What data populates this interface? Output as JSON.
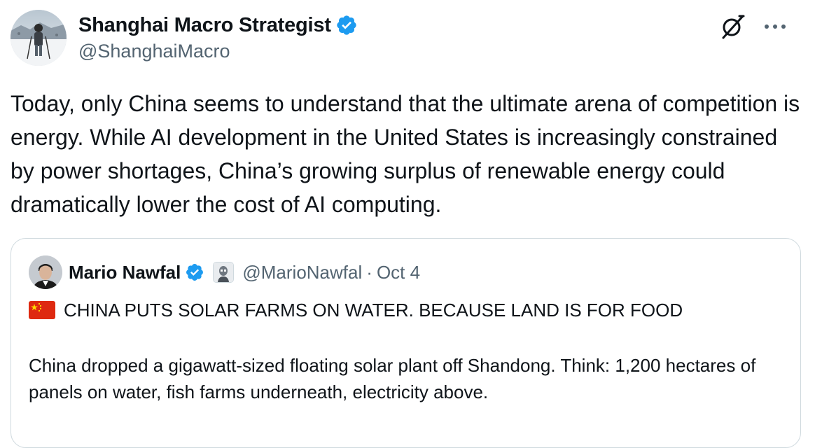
{
  "tweet": {
    "author": {
      "display_name": "Shanghai Macro Strategist",
      "handle": "@ShanghaiMacro",
      "verified": true,
      "avatar_icon": "person-skiing-avatar"
    },
    "actions": {
      "grok_icon": "grok-icon",
      "more_icon": "more-options-icon"
    },
    "text": "Today, only China seems to understand that the ultimate arena of competition is energy. While AI development in the United States is increasingly constrained by power shortages, China’s growing surplus of renewable energy could dramatically lower the cost of AI computing."
  },
  "quote": {
    "author": {
      "display_name": "Mario Nawfal",
      "handle": "@MarioNawfal",
      "verified": true,
      "affiliate_badge_icon": "affiliate-badge-icon"
    },
    "separator": "·",
    "date": "Oct 4",
    "headline_flag": "china-flag-icon",
    "headline": "CHINA PUTS SOLAR FARMS ON WATER. BECAUSE LAND IS FOR FOOD",
    "body": "China dropped a gigawatt-sized floating solar plant off Shandong. Think: 1,200 hectares of panels on water, fish farms underneath, electricity above."
  },
  "colors": {
    "text_primary": "#0f1419",
    "text_secondary": "#536471",
    "verified_blue": "#1d9bf0",
    "border": "#cfd9de",
    "flag_red": "#de2910",
    "flag_yellow": "#ffde00"
  }
}
